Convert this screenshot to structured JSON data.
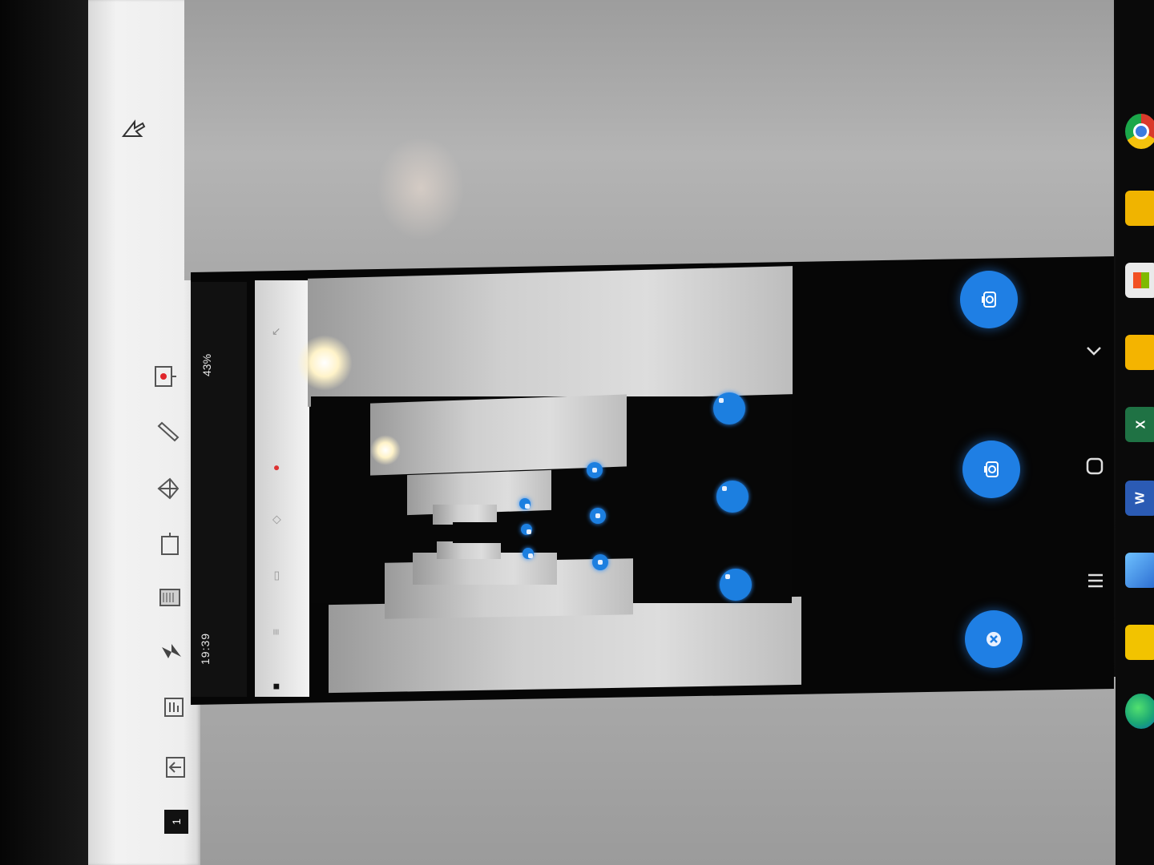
{
  "status_bar": {
    "time": "19:39",
    "battery": "43%"
  },
  "toolbar": {
    "page_number": "1",
    "tools": [
      {
        "id": "pointer",
        "icon": "pointer-icon"
      },
      {
        "id": "record",
        "icon": "record-icon"
      },
      {
        "id": "pen",
        "icon": "pen-icon"
      },
      {
        "id": "shape",
        "icon": "shape-icon"
      },
      {
        "id": "screen",
        "icon": "screen-icon"
      },
      {
        "id": "keyboard",
        "icon": "keyboard-icon"
      },
      {
        "id": "flash",
        "icon": "flash-icon"
      },
      {
        "id": "notes",
        "icon": "notes-icon"
      },
      {
        "id": "upload",
        "icon": "upload-icon"
      },
      {
        "id": "page",
        "icon": "page-icon"
      }
    ]
  },
  "floating_buttons": [
    {
      "id": "capture-1",
      "icon": "camera-icon"
    },
    {
      "id": "capture-2",
      "icon": "camera-icon"
    },
    {
      "id": "close",
      "icon": "close-icon"
    }
  ],
  "nav_buttons": [
    {
      "id": "back",
      "icon": "chevron-icon"
    },
    {
      "id": "home",
      "icon": "home-icon"
    },
    {
      "id": "recents",
      "icon": "recents-icon"
    }
  ],
  "taskbar": [
    {
      "id": "chrome",
      "icon": "chrome-icon",
      "color": "#d93a2b"
    },
    {
      "id": "folder",
      "icon": "folder-icon",
      "color": "#f0b400"
    },
    {
      "id": "store",
      "icon": "store-icon",
      "color": "#1e6fd6"
    },
    {
      "id": "files",
      "icon": "files-icon",
      "color": "#f4b400"
    },
    {
      "id": "excel",
      "icon": "excel-icon",
      "color": "#1f7244",
      "label": "X"
    },
    {
      "id": "word",
      "icon": "word-icon",
      "color": "#2b5bb4",
      "label": "W"
    },
    {
      "id": "app-blue",
      "icon": "app-icon",
      "color": "#3a7bd5"
    },
    {
      "id": "sticky",
      "icon": "sticky-icon",
      "color": "#f2c300"
    },
    {
      "id": "edge",
      "icon": "edge-icon",
      "color": "#1ba774"
    }
  ]
}
